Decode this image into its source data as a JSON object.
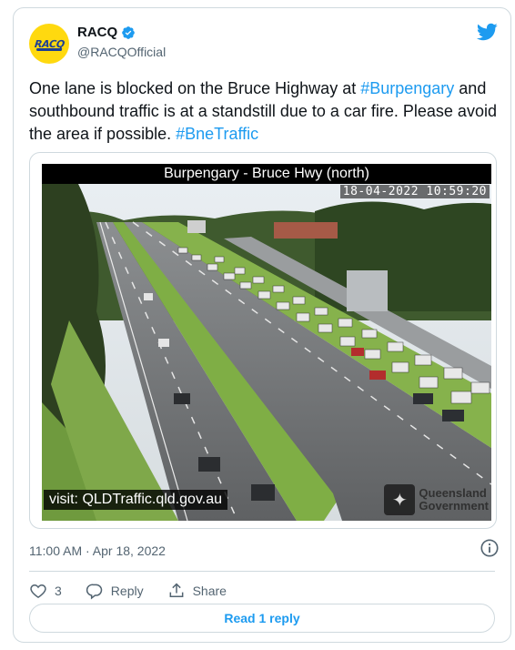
{
  "tweet": {
    "author_name": "RACQ",
    "handle": "@RACQOfficial",
    "avatar_text": "RACQ",
    "text_parts": {
      "p1": "One lane is blocked on the Bruce Highway at ",
      "tag1": "#Burpengary",
      "p2": " and southbound traffic is at a standstill due to a car fire. Please avoid the area if possible. ",
      "tag2": "#BneTraffic"
    },
    "timestamp": "11:00 AM · Apr 18, 2022",
    "likes_count": "3",
    "reply_label": "Reply",
    "share_label": "Share",
    "read_replies_label": "Read 1 reply"
  },
  "camera": {
    "title": "Burpengary - Bruce Hwy (north)",
    "timestamp_overlay": "18-04-2022 10:59:20",
    "visit_text": "visit: QLDTraffic.qld.gov.au",
    "gov_line1": "Queensland",
    "gov_line2": "Government"
  },
  "icons": {
    "verified": "verified-badge-icon",
    "twitter": "twitter-bird-icon",
    "info": "info-icon",
    "like": "heart-icon",
    "reply": "reply-bubble-icon",
    "share": "share-icon"
  },
  "colors": {
    "accent": "#1d9bf0",
    "avatar_bg": "#ffd90f",
    "text": "#0f1419",
    "muted": "#536471"
  }
}
